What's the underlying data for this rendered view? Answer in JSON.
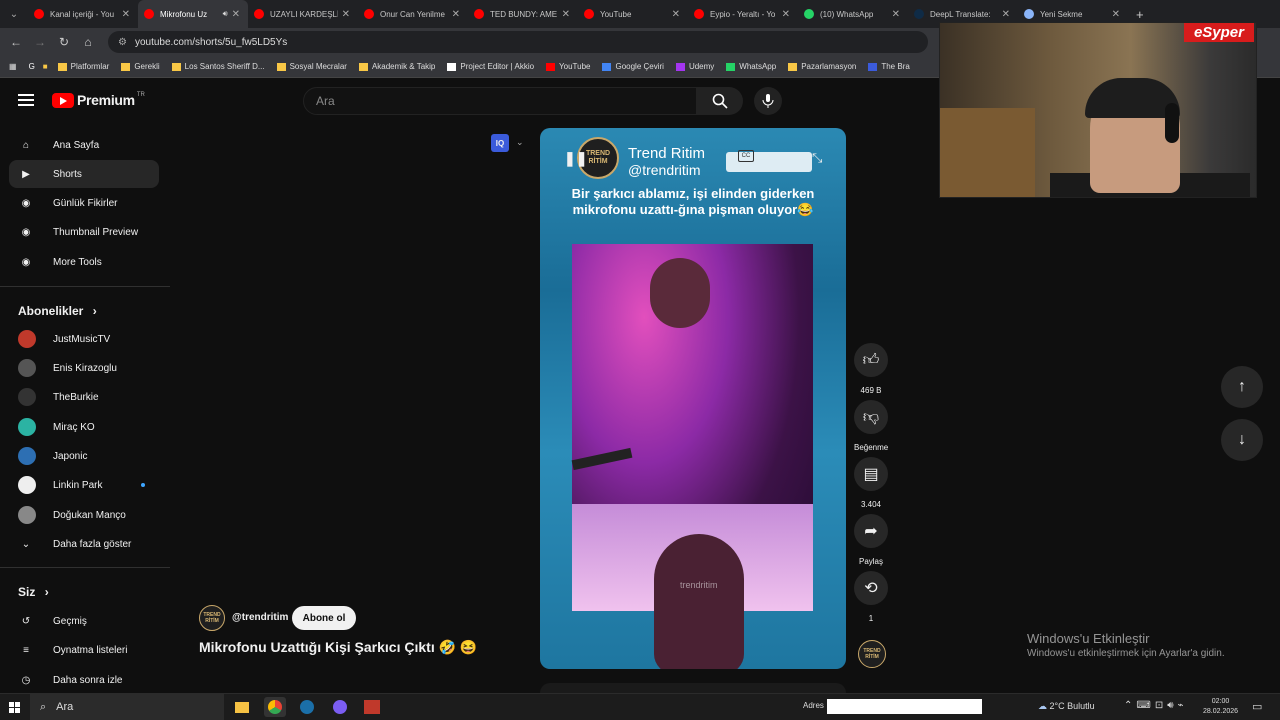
{
  "browser": {
    "tabs": [
      {
        "label": "Kanal içeriği - You",
        "color": "#ff0000",
        "active": false
      },
      {
        "label": "Mikrofonu Uz",
        "color": "#ff0000",
        "active": true
      },
      {
        "label": "UZAYLI KARDEŞLİ",
        "color": "#ff0000",
        "active": false
      },
      {
        "label": "Onur Can Yenilme",
        "color": "#ff0000",
        "active": false
      },
      {
        "label": "TED BUNDY: AME",
        "color": "#ff0000",
        "active": false
      },
      {
        "label": "YouTube",
        "color": "#ff0000",
        "active": false
      },
      {
        "label": "Eypio - Yeraltı - Yo",
        "color": "#ff0000",
        "active": false
      },
      {
        "label": "(10) WhatsApp",
        "color": "#25d366",
        "active": false
      },
      {
        "label": "DeepL Translate: ",
        "color": "#0f2b46",
        "active": false
      },
      {
        "label": "Yeni Sekme",
        "color": "#8ab4f8",
        "active": false
      }
    ],
    "url": "youtube.com/shorts/5u_fw5LD5Ys",
    "bookmarks": [
      {
        "label": "Platformlar",
        "color": "#f9c846"
      },
      {
        "label": "Gerekli",
        "color": "#f9c846"
      },
      {
        "label": "Los Santos Sheriff D...",
        "color": "#f9c846"
      },
      {
        "label": "Sosyal Mecralar",
        "color": "#f9c846"
      },
      {
        "label": "Akademik & Takip",
        "color": "#f9c846"
      },
      {
        "label": "Project Editor | Akkio",
        "color": "#ffffff"
      },
      {
        "label": "YouTube",
        "color": "#ff0000"
      },
      {
        "label": "Google Çeviri",
        "color": "#4285f4"
      },
      {
        "label": "Udemy",
        "color": "#a435f0"
      },
      {
        "label": "WhatsApp",
        "color": "#25d366"
      },
      {
        "label": "Pazarlamasyon",
        "color": "#f9c846"
      },
      {
        "label": "The Bra",
        "color": "#3b5bdb"
      }
    ]
  },
  "youtube": {
    "logo_text": "Premium",
    "logo_sup": "TR",
    "search_placeholder": "Ara",
    "sidebar": {
      "main": [
        {
          "label": "Ana Sayfa",
          "icon": "home-icon"
        },
        {
          "label": "Shorts",
          "icon": "shorts-icon"
        },
        {
          "label": "Günlük Fikirler",
          "icon": "extension-icon"
        },
        {
          "label": "Thumbnail Preview",
          "icon": "extension-icon"
        },
        {
          "label": "More Tools",
          "icon": "extension-icon"
        }
      ],
      "subs_title": "Abonelikler",
      "subs": [
        {
          "label": "JustMusicTV",
          "color": "#c0392b"
        },
        {
          "label": "Enis Kirazoglu",
          "color": "#555555"
        },
        {
          "label": "TheBurkie",
          "color": "#333333"
        },
        {
          "label": "Miraç KO",
          "color": "#2bb3a3"
        },
        {
          "label": "Japonic",
          "color": "#2d6fb3"
        },
        {
          "label": "Linkin Park",
          "color": "#eeeeee"
        },
        {
          "label": "Doğukan Manço",
          "color": "#888888"
        }
      ],
      "show_more": "Daha fazla göster",
      "you_title": "Siz",
      "you": [
        {
          "label": "Geçmiş",
          "icon": "history-icon"
        },
        {
          "label": "Oynatma listeleri",
          "icon": "playlist-icon"
        },
        {
          "label": "Daha sonra izle",
          "icon": "clock-icon"
        }
      ]
    },
    "short": {
      "channel_name": "Trend Ritim",
      "channel_handle": "@trendritim",
      "logo_text": "TREND RİTİM",
      "caption": "Bir şarkıcı ablamız, işi elinden giderken mikrofonu uzattı-ğına pişman oluyor😂",
      "watermark": "trendritim",
      "title": "Mikrofonu Uzattığı Kişi Şarkıcı Çıktı 🤣 😆",
      "subscribe_label": "Abone ol"
    },
    "actions": {
      "likes": "469 B",
      "dislike": "Beğenme",
      "comments": "3.404",
      "share": "Paylaş",
      "remix": "1"
    }
  },
  "overlay": {
    "webcam_brand": "eSyper",
    "windows_activate_title": "Windows'u Etkinleştir",
    "windows_activate_sub": "Windows'u etkinleştirmek için Ayarlar'a gidin."
  },
  "taskbar": {
    "search": "Ara",
    "address_label": "Adres",
    "weather": "2°C  Bulutlu",
    "time": "02:00",
    "date": "28.02.2026"
  }
}
